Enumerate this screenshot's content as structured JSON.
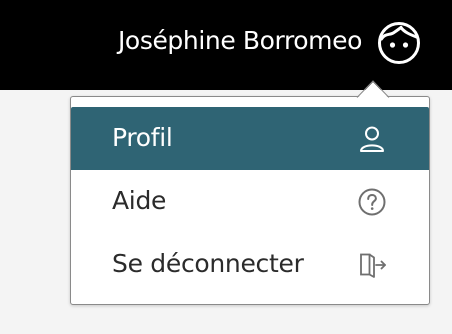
{
  "header": {
    "user_name": "Joséphine Borromeo",
    "avatar_icon": "face-icon"
  },
  "menu": {
    "items": [
      {
        "label": "Profil",
        "icon": "user-icon",
        "active": true
      },
      {
        "label": "Aide",
        "icon": "help-circle-icon",
        "active": false
      },
      {
        "label": "Se déconnecter",
        "icon": "logout-door-icon",
        "active": false
      }
    ]
  },
  "colors": {
    "topbar_bg": "#000000",
    "active_item_bg": "#2f6474",
    "menu_text": "#2b2b2b",
    "icon_gray": "#6f6f6f",
    "page_bg": "#f4f4f4"
  }
}
